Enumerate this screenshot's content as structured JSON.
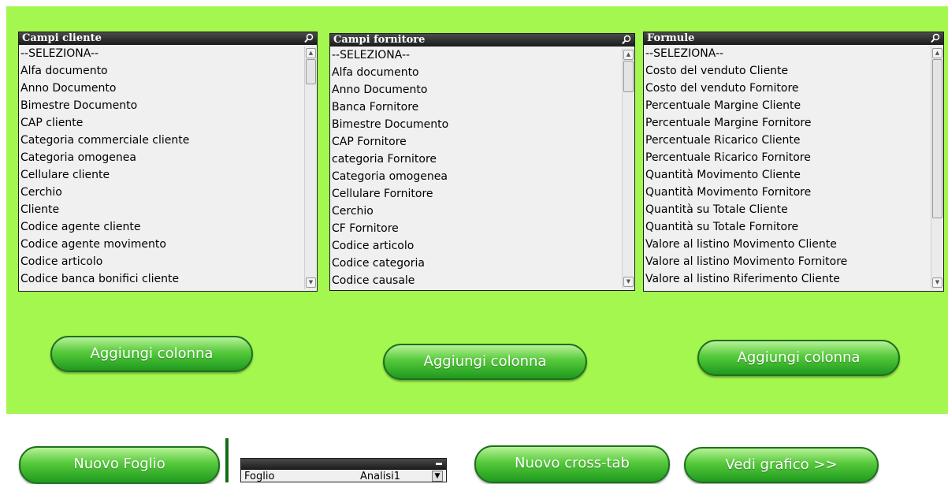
{
  "lists": [
    {
      "title": "Campi cliente",
      "items": [
        "--SELEZIONA--",
        "Alfa documento",
        "Anno Documento",
        "Bimestre Documento",
        "CAP cliente",
        "Categoria commerciale cliente",
        "Categoria omogenea",
        "Cellulare cliente",
        "Cerchio",
        "Cliente",
        "Codice agente cliente",
        "Codice agente movimento",
        "Codice articolo",
        "Codice banca bonifici cliente"
      ]
    },
    {
      "title": "Campi fornitore",
      "items": [
        "--SELEZIONA--",
        "Alfa documento",
        "Anno Documento",
        "Banca Fornitore",
        "Bimestre Documento",
        "CAP Fornitore",
        "categoria Fornitore",
        "Categoria omogenea",
        "Cellulare Fornitore",
        "Cerchio",
        "CF Fornitore",
        "Codice articolo",
        "Codice categoria",
        "Codice causale"
      ]
    },
    {
      "title": "Formule",
      "items": [
        "--SELEZIONA--",
        "Costo del venduto Cliente",
        "Costo del venduto Fornitore",
        "Percentuale Margine Cliente",
        "Percentuale Margine Fornitore",
        "Percentuale Ricarico Cliente",
        "Percentuale Ricarico Fornitore",
        "Quantità Movimento Cliente",
        "Quantità Movimento Fornitore",
        "Quantità su Totale Cliente",
        "Quantità su Totale Fornitore",
        "Valore al listino Movimento Cliente",
        "Valore al listino Movimento Fornitore",
        "Valore al listino Riferimento Cliente"
      ]
    }
  ],
  "buttons": {
    "add_column": "Aggiungi colonna",
    "new_sheet": "Nuovo Foglio",
    "new_crosstab": "Nuovo cross-tab",
    "view_chart": "Vedi grafico >>"
  },
  "sheet_selector": {
    "label": "Foglio",
    "value": "Analisi1"
  },
  "colors": {
    "panel_bg": "#a3f74f",
    "header_bg": "#1a1a1a",
    "button_green": "#2fb52a"
  },
  "icons": {
    "search": "search-icon",
    "scroll_up": "scroll-up-icon",
    "scroll_down": "scroll-down-icon",
    "minimize": "minimize-icon",
    "dropdown": "dropdown-arrow-icon"
  }
}
